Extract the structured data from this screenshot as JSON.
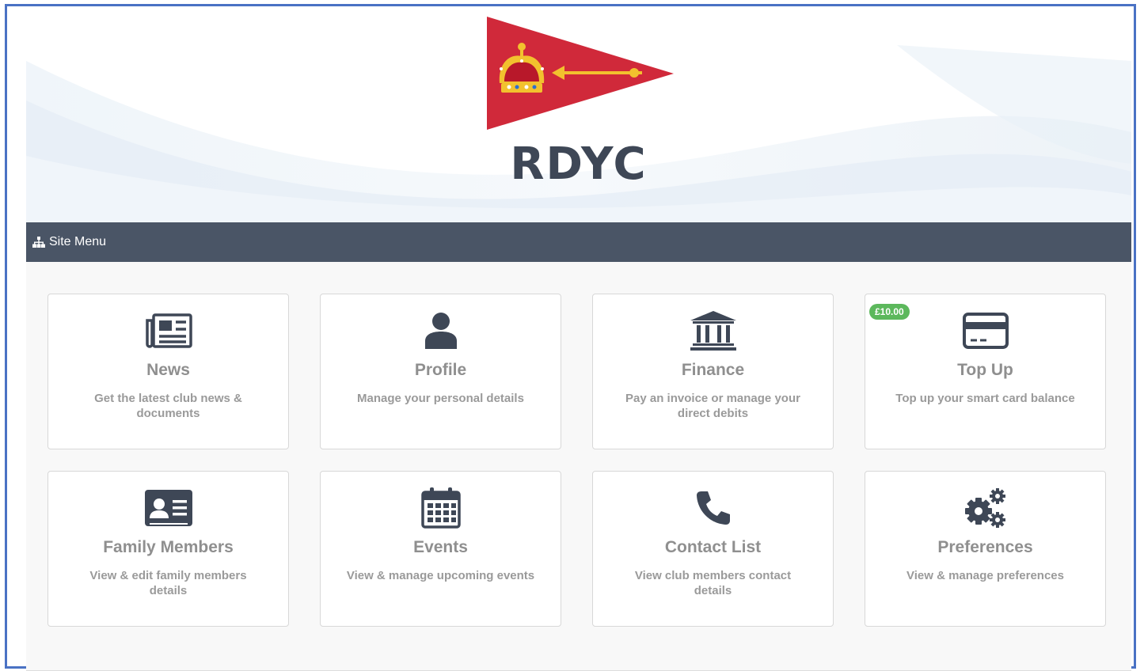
{
  "brand": {
    "name": "RDYC"
  },
  "menubar": {
    "label": "Site Menu",
    "icon": "sitemap-icon"
  },
  "colors": {
    "menubar": "#4a5566",
    "pennant": "#d0293a",
    "badge": "#5cb85c",
    "icons": "#3e4756"
  },
  "cards": [
    {
      "title": "News",
      "desc": "Get the latest club news & documents",
      "icon": "newspaper-icon"
    },
    {
      "title": "Profile",
      "desc": "Manage your personal details",
      "icon": "user-icon"
    },
    {
      "title": "Finance",
      "desc": "Pay an invoice or manage your direct debits",
      "icon": "bank-icon"
    },
    {
      "title": "Top Up",
      "desc": "Top up your smart card balance",
      "icon": "credit-card-icon",
      "badge": "£10.00"
    },
    {
      "title": "Family Members",
      "desc": "View & edit family members details",
      "icon": "id-card-icon"
    },
    {
      "title": "Events",
      "desc": "View & manage upcoming events",
      "icon": "calendar-icon"
    },
    {
      "title": "Contact List",
      "desc": "View club members contact details",
      "icon": "phone-icon"
    },
    {
      "title": "Preferences",
      "desc": "View & manage preferences",
      "icon": "gears-icon"
    }
  ]
}
